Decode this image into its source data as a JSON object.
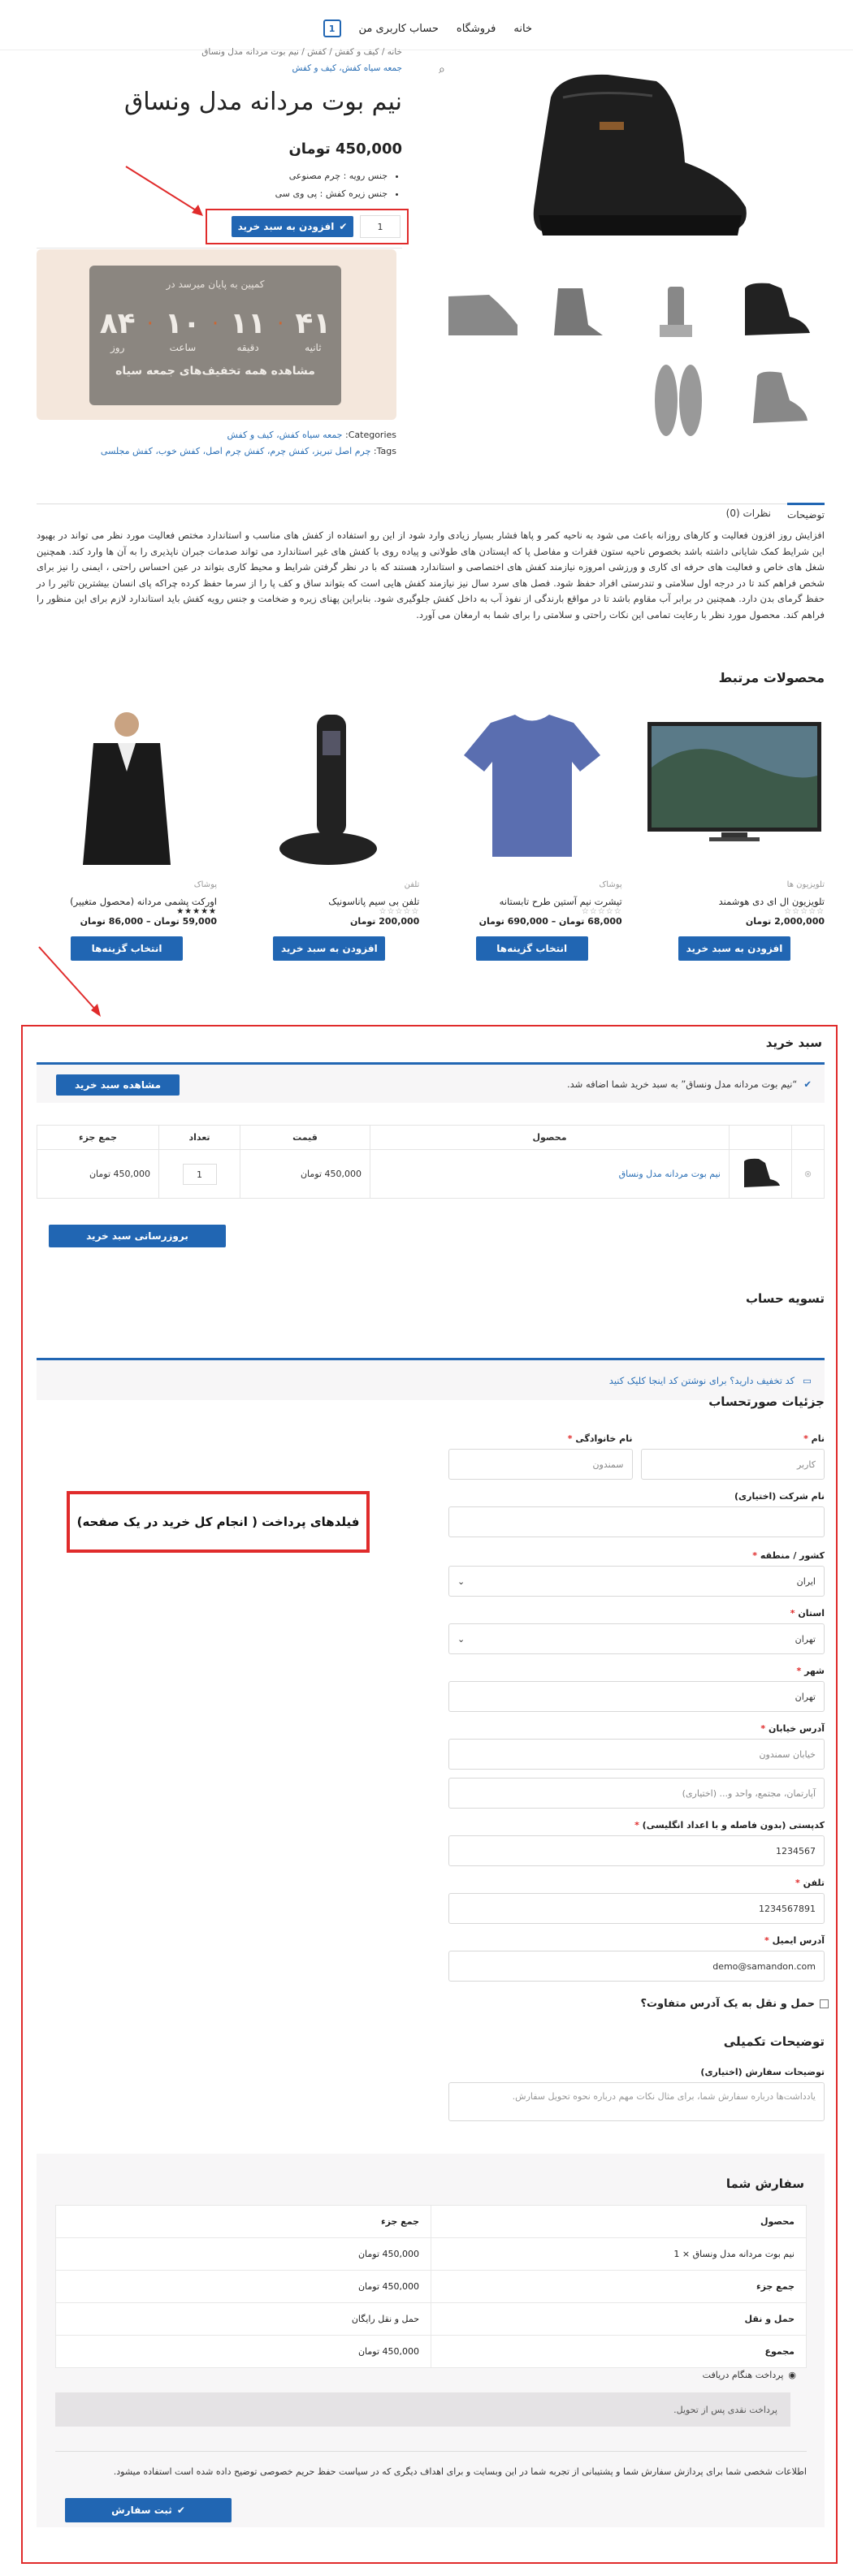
{
  "header": {
    "nav": [
      "خانه",
      "فروشگاه",
      "حساب کاربری من"
    ],
    "cart_count": "1"
  },
  "product": {
    "breadcrumb": "خانه / کیف و کفش / کفش / نیم بوت مردانه مدل ونساق",
    "category_link": "جمعه سیاه کفش، کیف و کفش",
    "title": "نیم بوت مردانه مدل ونساق",
    "price": "450,000 تومان",
    "attrs": [
      "جنس رویه : چرم مصنوعی",
      "جنس زیره کفش : پی وی سی"
    ],
    "qty": "1",
    "add_to_cart": "افزودن به سبد خرید",
    "countdown": {
      "top": "کمپین به پایان میرسد در",
      "days": "۸۴",
      "days_label": "روز",
      "hours": "۱۰",
      "hours_label": "ساعت",
      "minutes": "۱۱",
      "minutes_label": "دقیقه",
      "seconds": "۴۱",
      "seconds_label": "ثانیه",
      "bottom": "مشاهده همه تخفیف‌های جمعه سیاه"
    },
    "categories_label": "Categories:",
    "categories": "جمعه سیاه کفش، کیف و کفش",
    "tags_label": "Tags:",
    "tags": "چرم اصل تبریز، کفش چرم، کفش چرم اصل، کفش خوب، کفش مجلسی"
  },
  "tabs": {
    "desc": "توضیحات",
    "reviews": "نظرات (0)"
  },
  "description": "افزایش روز افزون فعالیت و کارهای روزانه باعث می شود به ناحیه کمر و پاها فشار بسیار زیادی وارد شود از این رو استفاده از کفش های مناسب و استاندارد مختص فعالیت مورد نظر می تواند در بهبود این شرایط کمک شایانی داشته باشد بخصوص ناحیه ستون فقرات و مفاصل پا که ایستادن های طولانی و پیاده روی با کفش های غیر استاندارد می تواند صدمات جبران ناپذیری را به آن ها وارد کند. همچنین شغل های خاص و فعالیت های حرفه ای کاری و ورزشی امروزه نیازمند کفش های اختصاصی و استاندارد هستند که با در نظر گرفتن شرایط و محیط کاری بتواند در عین احساس راحتی ، ایمنی را نیز برای شخص فراهم کند تا در درجه اول سلامتی و تندرستی افراد حفظ شود. فصل های سرد سال نیز نیازمند کفش هایی است که بتواند ساق و کف پا را از سرما حفظ کرده چراکه پای انسان بیشترین تاثیر را در حفظ گرمای بدن دارد. همچنین در برابر آب مقاوم باشد تا در مواقع بارندگی از نفوذ آب به داخل کفش جلوگیری شود. بنابراین پهنای زیره و ضخامت و جنس رویه کفش باید استاندارد لازم برای این منظور را فراهم کند. محصول مورد نظر با رعایت تمامی این نکات راحتی و سلامتی را برای شما به ارمغان می آورد.",
  "related": {
    "title": "محصولات مرتبط",
    "items": [
      {
        "cat": "تلویزیون ها",
        "name": "تلویزیون ال ای دی هوشمند",
        "stars": "☆☆☆☆☆",
        "price": "2,000,000 تومان",
        "btn": "افزودن به سبد خرید"
      },
      {
        "cat": "پوشاک",
        "name": "تیشرت نیم آستین طرح تابستانه",
        "stars": "☆☆☆☆☆",
        "price": "68,000 تومان – 690,000 تومان",
        "btn": "انتخاب گزینه‌ها"
      },
      {
        "cat": "تلفن",
        "name": "تلفن بی سیم پاناسونیک",
        "stars": "☆☆☆☆☆",
        "price": "200,000 تومان",
        "btn": "افزودن به سبد خرید"
      },
      {
        "cat": "پوشاک",
        "name": "اورکت پشمی مردانه (محصول متغییر)",
        "stars": "★★★★★",
        "price": "59,000 تومان – 86,000 تومان",
        "btn": "انتخاب گزینه‌ها"
      }
    ]
  },
  "cart": {
    "title": "سبد خرید",
    "notice": "“نیم بوت مردانه مدل ونساق” به سبد خرید شما اضافه شد.",
    "view_cart": "مشاهده سبد خرید",
    "headers": [
      "محصول",
      "قیمت",
      "تعداد",
      "جمع جزء"
    ],
    "row": {
      "name": "نیم بوت مردانه مدل ونساق",
      "price": "450,000 تومان",
      "qty": "1",
      "subtotal": "450,000 تومان"
    },
    "update": "بروزرسانی سبد خرید"
  },
  "checkout": {
    "title": "تسویه حساب",
    "coupon": "کد تخفیف دارید؟ برای نوشتن کد اینجا کلیک کنید",
    "billing_title": "جزئیات صورتحساب",
    "first_name_label": "نام",
    "first_name": "کاربر",
    "last_name_label": "نام خانوادگی",
    "last_name": "سمندون",
    "company_label": "نام شرکت (اختیاری)",
    "country_label": "کشور / منطقه",
    "country": "ایران",
    "state_label": "استان",
    "state": "تهران",
    "city_label": "شهر",
    "city": "تهران",
    "address_label": "آدرس خیابان",
    "address": "خیابان سمندون",
    "address2": "آپارتمان، مجتمع، واحد و... (اختیاری)",
    "postcode_label": "کدپستی (بدون فاصله و با اعداد انگلیسی)",
    "postcode": "1234567",
    "phone_label": "تلفن",
    "phone": "1234567891",
    "email_label": "آدرس ایمیل",
    "email": "demo@samandon.com",
    "ship_diff": "حمل و نقل به یک آدرس متفاوت؟",
    "extra_title": "توضیحات تکمیلی",
    "notes_label": "توضیحات سفارش (اختیاری)",
    "notes_ph": "یادداشت‌ها درباره سفارش شما، برای مثال نکات مهم درباره نحوه تحویل سفارش.",
    "annotation": "فیلدهای پرداخت ( انجام کل خرید در یک صفحه)"
  },
  "order": {
    "title": "سفارش شما",
    "head": [
      "محصول",
      "جمع جزء"
    ],
    "rows": [
      [
        "نیم بوت مردانه مدل ونساق  × 1",
        "450,000 تومان"
      ],
      [
        "جمع جزء",
        "450,000 تومان"
      ],
      [
        "حمل و نقل",
        "حمل و نقل رایگان"
      ],
      [
        "مجموع",
        "450,000 تومان"
      ]
    ],
    "payment": "پرداخت هنگام دریافت",
    "payment_desc": "پرداخت نقدی پس از تحویل.",
    "privacy": "اطلاعات شخصی شما برای پردازش سفارش شما و پشتیبانی از تجربه شما در این وبسایت و برای اهداف دیگری که در سیاست حفظ حریم خصوصی توضیح داده شده است استفاده میشود.",
    "place_order": "ثبت سفارش"
  }
}
